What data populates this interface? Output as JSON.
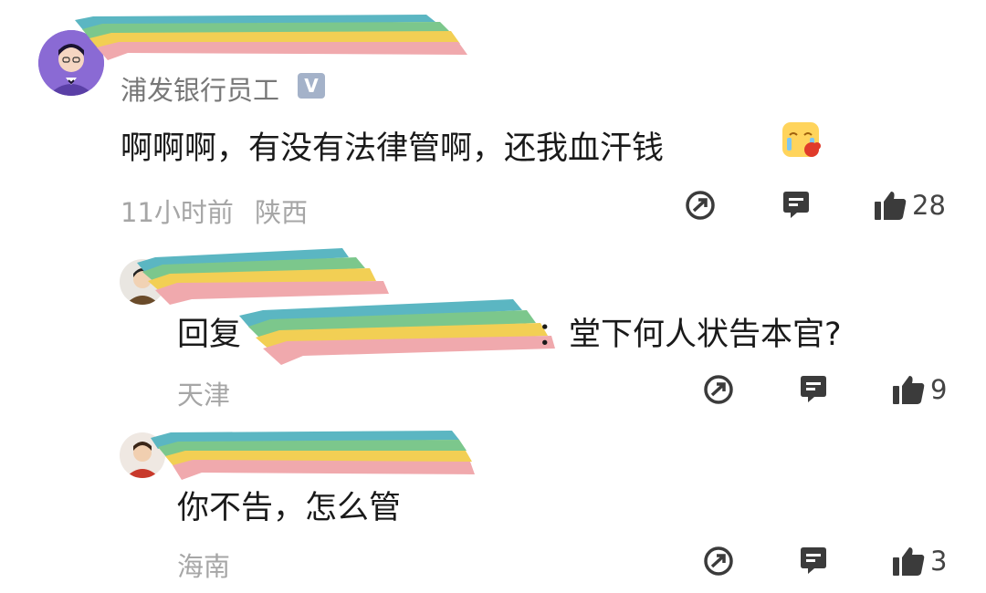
{
  "comments": [
    {
      "user": "浦发银行员工",
      "verified_badge": "V",
      "text": "啊啊啊，有没有法律管啊，还我血汗钱",
      "emoji": "crying-face-emoji",
      "time": "11小时前",
      "location": "陕西",
      "likes": "28"
    }
  ],
  "replies": [
    {
      "text_prefix": "回复",
      "text_suffix": "：堂下何人状告本官?",
      "location": "天津",
      "likes": "9"
    },
    {
      "text": "你不告，怎么管",
      "location": "海南",
      "likes": "3"
    }
  ],
  "icons": {
    "share": "share-icon",
    "reply": "comment-icon",
    "like": "thumbs-up-icon"
  }
}
